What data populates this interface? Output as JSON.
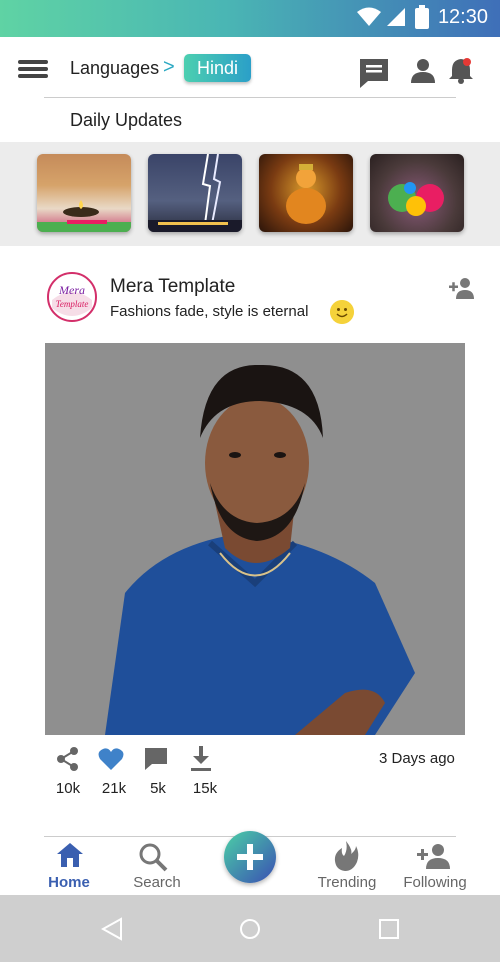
{
  "status_bar": {
    "time": "12:30"
  },
  "header": {
    "languages_label": "Languages",
    "selected_language": "Hindi",
    "section_title": "Daily Updates"
  },
  "stories": [
    {
      "name": "diya-lamp"
    },
    {
      "name": "lightning-city"
    },
    {
      "name": "ganesha-idol"
    },
    {
      "name": "holi-colors"
    }
  ],
  "post": {
    "author": "Mera Template",
    "caption": "Fashions fade, style is eternal",
    "logo_text_top": "Mera",
    "logo_text_bottom": "Template",
    "time": "3 Days ago",
    "counts": {
      "shares": "10k",
      "likes": "21k",
      "comments": "5k",
      "downloads": "15k"
    }
  },
  "bottom_nav": {
    "items": [
      {
        "label": "Home",
        "active": true
      },
      {
        "label": "Search",
        "active": false
      },
      {
        "label": "Trending",
        "active": false
      },
      {
        "label": "Following",
        "active": false
      }
    ]
  },
  "colors": {
    "accent": "#2aa8c2",
    "active_nav": "#3a5fb0",
    "heart": "#3f82c9",
    "notification_dot": "#e53935"
  }
}
